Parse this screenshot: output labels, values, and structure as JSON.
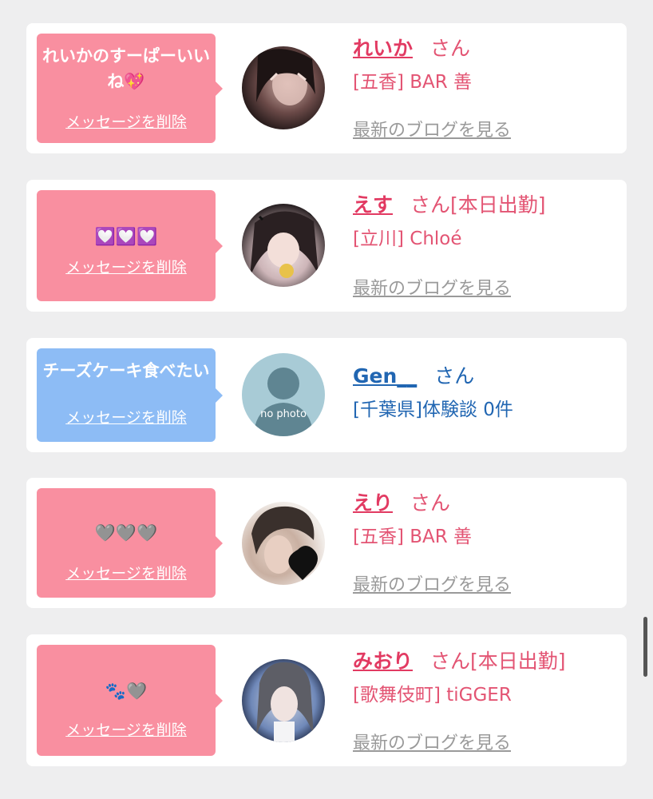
{
  "delete_label": "メッセージを削除",
  "san_label": "さん",
  "blog_label": "最新のブログを見る",
  "cards": [
    {
      "message": "れいかのすーぱーいいね💖",
      "name": "れいか",
      "status": "",
      "shop": "[五香] BAR 善",
      "theme": "pink"
    },
    {
      "message": "💟💟💟",
      "name": "えす",
      "status": "[本日出勤]",
      "shop": "[立川] Chloé",
      "theme": "pink"
    },
    {
      "message": "チーズケーキ食べたい",
      "name": "Gen__",
      "status": "",
      "shop": "[千葉県]体験談 0件",
      "theme": "blue",
      "avatar_text": "no photo"
    },
    {
      "message": "🩶🩶🩶",
      "name": "えり",
      "status": "",
      "shop": "[五香] BAR 善",
      "theme": "pink"
    },
    {
      "message": "🐾🩶",
      "name": "みおり",
      "status": "[本日出勤]",
      "shop": "[歌舞伎町] tiGGER",
      "theme": "pink"
    }
  ],
  "colors": {
    "pink_bubble": "#f98fa0",
    "blue_bubble": "#8dbcf5",
    "pink_text": "#e35473",
    "blue_text": "#2166b2",
    "link_gray": "#9a9a9a"
  }
}
